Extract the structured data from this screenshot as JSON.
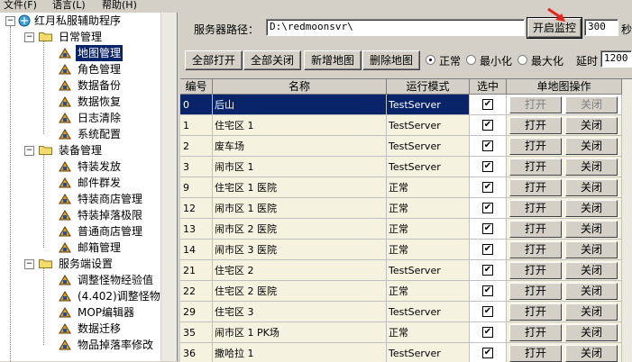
{
  "menubar": {
    "items": [
      "文件(F)",
      "语言(L)",
      "帮助(H)"
    ]
  },
  "tree": {
    "root": "红月私服辅助程序",
    "groups": [
      {
        "label": "日常管理",
        "items": [
          "地图管理",
          "角色管理",
          "数据备份",
          "数据恢复",
          "日志清除",
          "系统配置"
        ]
      },
      {
        "label": "装备管理",
        "items": [
          "特装发放",
          "邮件群发",
          "特装商店管理",
          "特装掉落极限",
          "普通商店管理",
          "邮箱管理"
        ]
      },
      {
        "label": "服务端设置",
        "items": [
          "调整怪物经验值",
          "(4.402)调整怪物",
          "MOP编辑器",
          "数据迁移",
          "物品掉落率修改"
        ]
      }
    ],
    "selected": "地图管理"
  },
  "server": {
    "path_label": "服务器路径：",
    "path_value": "D:\\redmoonsvr\\",
    "monitor_button": "开启监控",
    "interval_value": "300",
    "interval_unit": "秒"
  },
  "toolbar": {
    "open_all": "全部打开",
    "close_all": "全部关闭",
    "add_map": "新增地图",
    "delete_map": "删除地图",
    "window_modes": [
      "正常",
      "最小化",
      "最大化"
    ],
    "selected_mode": "正常",
    "delay_label": "延时",
    "delay_value": "1200"
  },
  "grid": {
    "headers": [
      "编号",
      "名称",
      "运行模式",
      "选中",
      "单地图操作"
    ],
    "open_label": "打开",
    "close_label": "关闭",
    "rows": [
      {
        "id": "0",
        "name": "后山",
        "mode": "TestServer",
        "checked": true
      },
      {
        "id": "1",
        "name": "住宅区 1",
        "mode": "TestServer",
        "checked": true
      },
      {
        "id": "2",
        "name": "废车场",
        "mode": "TestServer",
        "checked": true
      },
      {
        "id": "3",
        "name": "闹市区 1",
        "mode": "TestServer",
        "checked": true
      },
      {
        "id": "9",
        "name": "住宅区 1 医院",
        "mode": "正常",
        "checked": true
      },
      {
        "id": "12",
        "name": "闹市区 1 医院",
        "mode": "正常",
        "checked": true
      },
      {
        "id": "13",
        "name": "闹市区 2 医院",
        "mode": "正常",
        "checked": true
      },
      {
        "id": "14",
        "name": "闹市区 3 医院",
        "mode": "正常",
        "checked": true
      },
      {
        "id": "21",
        "name": "住宅区 2",
        "mode": "TestServer",
        "checked": true
      },
      {
        "id": "22",
        "name": "住宅区 2 医院",
        "mode": "正常",
        "checked": true
      },
      {
        "id": "29",
        "name": "住宅区 3",
        "mode": "TestServer",
        "checked": true
      },
      {
        "id": "35",
        "name": "闹市区 1 PK场",
        "mode": "正常",
        "checked": true
      },
      {
        "id": "36",
        "name": "撒哈拉 1",
        "mode": "TestServer",
        "checked": true
      }
    ]
  }
}
